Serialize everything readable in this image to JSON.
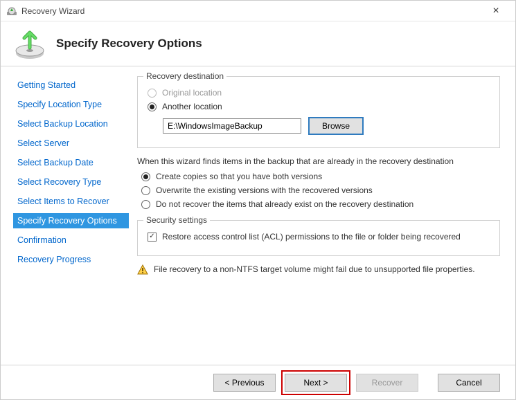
{
  "window": {
    "title": "Recovery Wizard"
  },
  "header": {
    "title": "Specify Recovery Options"
  },
  "sidebar": {
    "steps": [
      "Getting Started",
      "Specify Location Type",
      "Select Backup Location",
      "Select Server",
      "Select Backup Date",
      "Select Recovery Type",
      "Select Items to Recover",
      "Specify Recovery Options",
      "Confirmation",
      "Recovery Progress"
    ],
    "activeIndex": 7
  },
  "destination": {
    "legend": "Recovery destination",
    "original_label": "Original location",
    "another_label": "Another location",
    "path": "E:\\WindowsImageBackup",
    "browse_label": "Browse"
  },
  "conflict": {
    "intro": "When this wizard finds items in the backup that are already in the recovery destination",
    "opt_copies": "Create copies so that you have both versions",
    "opt_overwrite": "Overwrite the existing versions with the recovered versions",
    "opt_skip": "Do not recover the items that already exist on the recovery destination"
  },
  "security": {
    "legend": "Security settings",
    "acl_label": "Restore access control list (ACL) permissions to the file or folder being recovered"
  },
  "warning": {
    "text": "File recovery to a non-NTFS target volume might fail due to unsupported file properties."
  },
  "footer": {
    "previous": "< Previous",
    "next": "Next >",
    "recover": "Recover",
    "cancel": "Cancel"
  }
}
